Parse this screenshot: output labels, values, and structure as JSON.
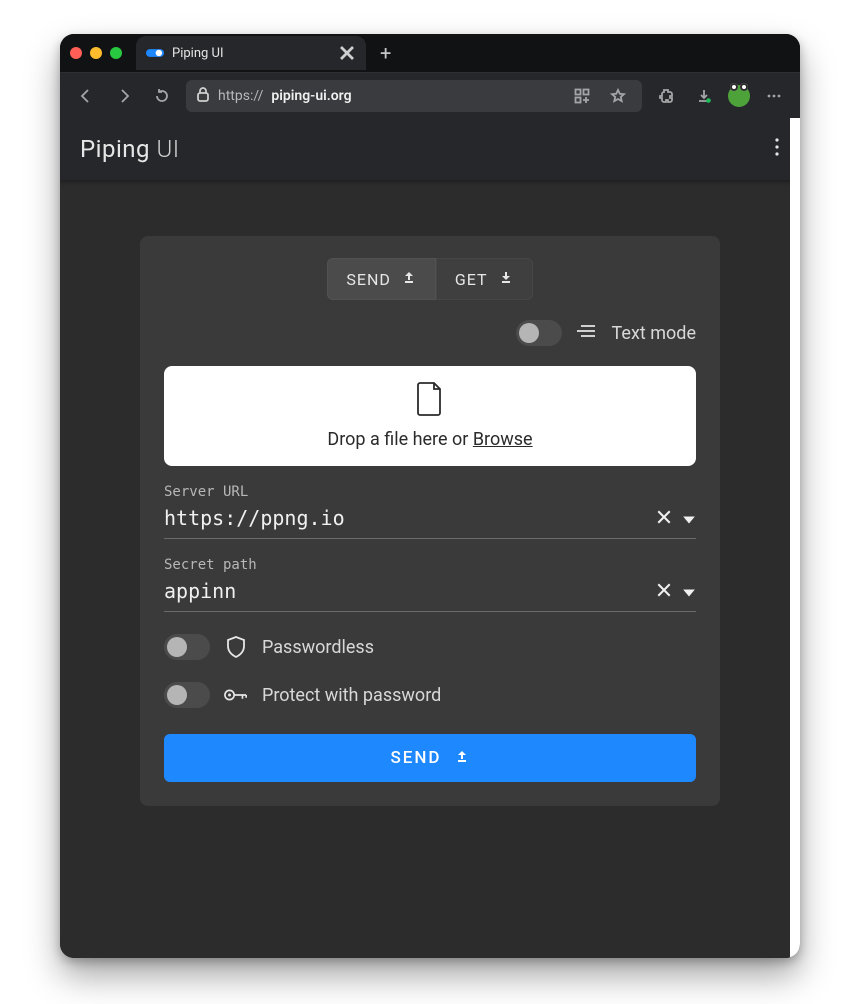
{
  "browser": {
    "tab_title": "Piping UI",
    "url_scheme": "https://",
    "url_host": "piping-ui.org"
  },
  "app": {
    "title_strong": "Piping",
    "title_thin": "UI",
    "tabs": {
      "send": "SEND",
      "get": "GET",
      "active": "send"
    },
    "text_mode": {
      "label": "Text mode",
      "enabled": false
    },
    "dropzone": {
      "text": "Drop a file here or ",
      "browse": "Browse"
    },
    "server": {
      "label": "Server URL",
      "value": "https://ppng.io"
    },
    "secret": {
      "label": "Secret path",
      "value": "appinn"
    },
    "options": {
      "passwordless": {
        "label": "Passwordless",
        "enabled": false
      },
      "protect_password": {
        "label": "Protect with password",
        "enabled": false
      }
    },
    "submit": "SEND"
  }
}
